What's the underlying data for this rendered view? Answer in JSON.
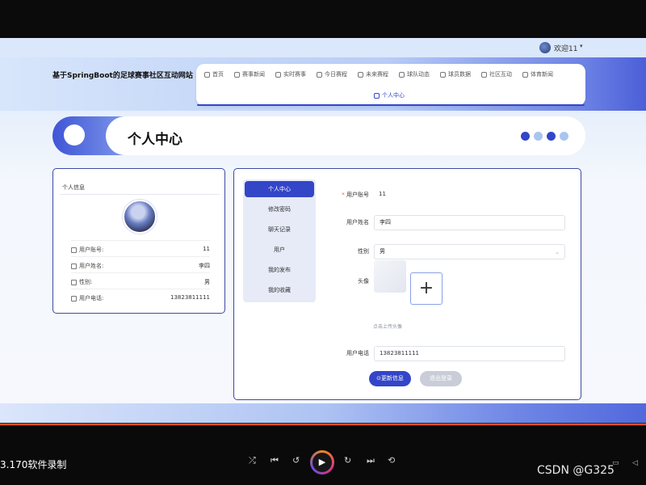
{
  "user": {
    "greeting": "欢迎11",
    "caret": "▾"
  },
  "site": {
    "title": "基于SpringBoot的足球赛事社区互动网站"
  },
  "nav": {
    "items": [
      {
        "label": "首页",
        "icon": "home-icon"
      },
      {
        "label": "赛事新闻",
        "icon": "star-icon"
      },
      {
        "label": "实时赛事",
        "icon": "grid-icon"
      },
      {
        "label": "今日赛程",
        "icon": "clock-icon"
      },
      {
        "label": "未来赛程",
        "icon": "clock-icon"
      },
      {
        "label": "球队动态",
        "icon": "clock-icon"
      },
      {
        "label": "球员数据",
        "icon": "gear-icon"
      },
      {
        "label": "社区互动",
        "icon": "gear-icon"
      },
      {
        "label": "体育新闻",
        "icon": "grid-icon"
      }
    ],
    "active": {
      "label": "个人中心",
      "icon": "home-icon"
    }
  },
  "banner": {
    "title": "个人中心",
    "dot_colors": [
      "#3346c8",
      "#a9c4f0",
      "#3346c8",
      "#a9c4f0"
    ]
  },
  "profile_card": {
    "title": "个人信息",
    "rows": [
      {
        "label": "用户账号:",
        "value": "11"
      },
      {
        "label": "用户姓名:",
        "value": "李四"
      },
      {
        "label": "性别:",
        "value": "男"
      },
      {
        "label": "用户电话:",
        "value": "13823811111"
      }
    ]
  },
  "side_menu": {
    "items": [
      "个人中心",
      "修改密码",
      "聊天记录",
      "用户",
      "我的发布",
      "我的收藏"
    ],
    "active_index": 0
  },
  "form": {
    "account_label": "用户账号",
    "account_value": "11",
    "name_label": "用户姓名",
    "name_value": "李四",
    "gender_label": "性别",
    "gender_value": "男",
    "avatar_label": "头像",
    "upload_symbol": "+",
    "upload_hint": "点击上传头像",
    "phone_label": "用户电话",
    "phone_value": "13823811111",
    "update_button": "更新信息",
    "logout_button": "退出登录"
  },
  "player": {
    "recorder_text": "3.170软件录制",
    "watermark": "CSDN @G325"
  },
  "colors": {
    "accent": "#3346c8",
    "border": "#3a4aa0",
    "progress": "#e0501e"
  }
}
